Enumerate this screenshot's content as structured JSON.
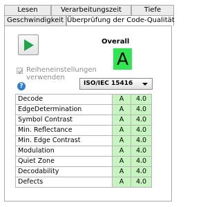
{
  "tabs": {
    "row1": [
      "Lesen",
      "Verarbeitungszeit",
      "Tiefe"
    ],
    "row2": [
      "Geschwindigkeit",
      "Überprüfung der Code-Qualität"
    ]
  },
  "overall": {
    "label": "Overall",
    "grade": "A"
  },
  "checkbox": {
    "label": "Reiheneinstellungen verwenden",
    "checked": true,
    "enabled": false
  },
  "standard": {
    "selected": "ISO/IEC 15416"
  },
  "rows": [
    {
      "name": "Decode",
      "grade": "A",
      "value": "4.0"
    },
    {
      "name": "EdgeDetermination",
      "grade": "A",
      "value": "4.0"
    },
    {
      "name": "Symbol Contrast",
      "grade": "A",
      "value": "4.0"
    },
    {
      "name": "Min. Reflectance",
      "grade": "A",
      "value": "4.0"
    },
    {
      "name": "Min. Edge Contrast",
      "grade": "A",
      "value": "4.0"
    },
    {
      "name": "Modulation",
      "grade": "A",
      "value": "4.0"
    },
    {
      "name": "Quiet Zone",
      "grade": "A",
      "value": "4.0"
    },
    {
      "name": "Decodability",
      "grade": "A",
      "value": "4.0"
    },
    {
      "name": "Defects",
      "grade": "A",
      "value": "4.0"
    }
  ],
  "colors": {
    "grade_green": "#2ee850",
    "cell_green": "#c6f5c0",
    "play_green": "#1aa84a",
    "help_blue": "#2f7fd6"
  },
  "icons": {
    "play": "play-icon",
    "help": "help-icon",
    "check": "check-icon",
    "dropdown": "chevron-down-icon"
  }
}
